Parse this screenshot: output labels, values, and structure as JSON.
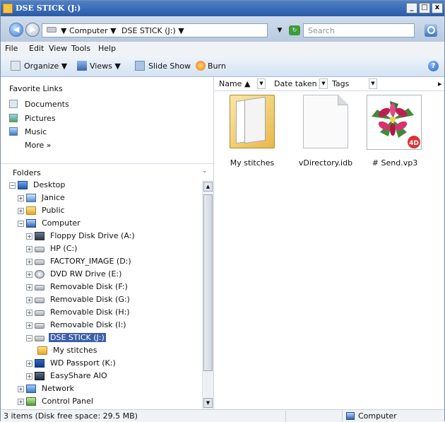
{
  "window": {
    "title": "DSE STICK (J:)",
    "min_label": "_",
    "max_label": "□",
    "close_label": "x"
  },
  "address": {
    "back_glyph": "◀",
    "forward_glyph": "▶",
    "crumbs": [
      "▼ Computer ▼",
      "DSE STICK (J:) ▼"
    ],
    "dropdown_glyph": "▼",
    "search_placeholder": "Search"
  },
  "menu": [
    "File",
    "Edit",
    "View",
    "Tools",
    "Help"
  ],
  "toolbar": {
    "organize": "Organize ▼",
    "views": "Views ▼",
    "slideshow": "Slide Show",
    "burn": "Burn",
    "help_glyph": "?"
  },
  "favorites": {
    "title": "Favorite Links",
    "items": [
      "Documents",
      "Pictures",
      "Music"
    ],
    "more": "More »"
  },
  "folders": {
    "title": "Folders",
    "chevron": "⌄",
    "tree": [
      {
        "label": "Desktop",
        "exp": "−"
      },
      {
        "label": "Janice",
        "exp": "+"
      },
      {
        "label": "Public",
        "exp": "+"
      },
      {
        "label": "Computer",
        "exp": "−"
      },
      {
        "label": "Floppy Disk Drive (A:)",
        "exp": "+"
      },
      {
        "label": "HP (C:)",
        "exp": "+"
      },
      {
        "label": "FACTORY_IMAGE (D:)",
        "exp": "+"
      },
      {
        "label": "DVD RW Drive (E:)",
        "exp": "+"
      },
      {
        "label": "Removable Disk (F:)",
        "exp": "+"
      },
      {
        "label": "Removable Disk (G:)",
        "exp": "+"
      },
      {
        "label": "Removable Disk (H:)",
        "exp": "+"
      },
      {
        "label": "Removable Disk (I:)",
        "exp": "+"
      },
      {
        "label": "DSE STICK (J:)",
        "exp": "−"
      },
      {
        "label": "My stitches",
        "exp": ""
      },
      {
        "label": "WD Passport (K:)",
        "exp": "+"
      },
      {
        "label": "EasyShare AIO",
        "exp": "+"
      },
      {
        "label": "Network",
        "exp": "+"
      },
      {
        "label": "Control Panel",
        "exp": "+"
      }
    ],
    "scroll_up": "▲",
    "scroll_down": "▼"
  },
  "columns": {
    "name": "Name ▲",
    "date": "Date taken",
    "tags": "Tags",
    "sep": "▼",
    "more": "▸"
  },
  "items": [
    {
      "name": "My stitches",
      "type": "folder-icon"
    },
    {
      "name": "vDirectory.idb",
      "type": "file-icon"
    },
    {
      "name": "# Send.vp3",
      "type": "embroidery-icon"
    }
  ],
  "status": {
    "text": "3 items (Disk free space: 29.5 MB)",
    "zone": "Computer"
  },
  "colors": {
    "title_bar": "#2a5aa6",
    "selection": "#3e5fa8",
    "toolbar": "#d4e2f2"
  }
}
